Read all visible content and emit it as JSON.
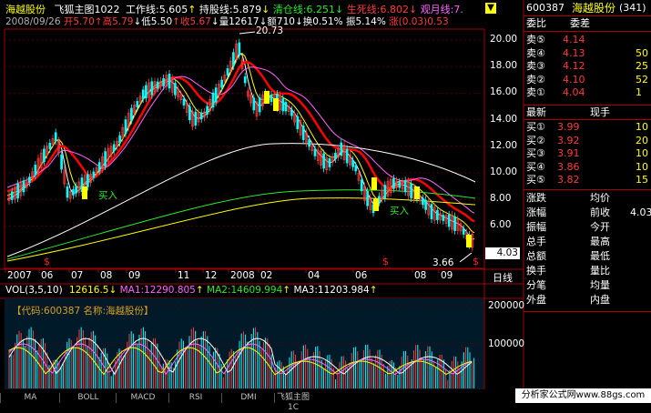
{
  "chart_header": {
    "stock_name": "海越股份",
    "indicator": "飞狐主图1022",
    "work_label": "工作线:5.605",
    "hold_label": "持股线:5.879",
    "clear_label": "清仓线:6.251",
    "life_label": "生死线:6.802",
    "month_label": "观月线:7."
  },
  "quote_line": {
    "date": "2008/09/26",
    "open": "开5.70",
    "high": "高5.79",
    "low": "低5.50",
    "close": "收5.67",
    "volume": "量12617",
    "amount": "额710",
    "turnover": "换0.51%",
    "amplitude": "振5.14%",
    "change": "涨(0.03)0.53"
  },
  "price_axis": [
    "20.00",
    "18.00",
    "16.00",
    "14.00",
    "12.00",
    "10.00",
    "8.00",
    "6.00"
  ],
  "current_price_tag": "4.03",
  "price_annotations": {
    "high": "20.73",
    "low": "3.66",
    "buy": "买入"
  },
  "time_axis": [
    "2007",
    "06",
    "07",
    "08",
    "09",
    "11",
    "12",
    "2008",
    "02",
    "04",
    "06",
    "08",
    "09"
  ],
  "period_label": "日线",
  "volume_header": {
    "vol_label": "VOL(3,5,10)",
    "vol_value": "12616.5",
    "ma1": "MA1:12290.805",
    "ma2": "MA2:14609.994",
    "ma3": "MA3:11203.984"
  },
  "volume_axis": [
    "200000",
    "100000"
  ],
  "volume_watermark": "【代码:600387 名称:海越股份】",
  "bottom_tabs": [
    "MA",
    "BOLL",
    "MACD",
    "RSI",
    "DMI",
    "飞狐主图1C"
  ],
  "right_panel": {
    "code": "600387",
    "name": "海越股份",
    "suffix": "(341)",
    "header_left": "委比",
    "header_right": "委差",
    "sell_rows": [
      {
        "label": "卖⑤",
        "price": "4.14"
      },
      {
        "label": "卖④",
        "price": "4.13",
        "vol": "50"
      },
      {
        "label": "卖③",
        "price": "4.12",
        "vol": "25"
      },
      {
        "label": "卖②",
        "price": "4.10",
        "vol": "52"
      },
      {
        "label": "卖①",
        "price": "4.04",
        "vol": "1"
      }
    ],
    "latest_label": "最新",
    "trade_label": "现手",
    "buy_rows": [
      {
        "label": "买①",
        "price": "3.99",
        "vol": "10"
      },
      {
        "label": "买②",
        "price": "3.92",
        "vol": "20"
      },
      {
        "label": "买③",
        "price": "3.91",
        "vol": "10"
      },
      {
        "label": "买④",
        "price": "3.86",
        "vol": "10"
      },
      {
        "label": "买⑤",
        "price": "3.82",
        "vol": "15"
      }
    ],
    "stats": [
      {
        "l": "涨跌",
        "r": "均价"
      },
      {
        "l": "涨幅",
        "r": "前收",
        "v": "4.03"
      },
      {
        "l": "振幅",
        "r": "今开"
      },
      {
        "l": "总手",
        "r": "最高"
      },
      {
        "l": "总额",
        "r": "最低"
      },
      {
        "l": "换手",
        "r": "量比"
      },
      {
        "l": "分笔",
        "r": "均量"
      },
      {
        "l": "外盘",
        "r": "内盘"
      }
    ]
  },
  "footer_banner": "分析家公式网www.88gs.com",
  "colors": {
    "bg": "#000000",
    "grid_red": "#a00000",
    "axis_red": "#ff0000",
    "up": "#ff3b3b",
    "down": "#00ffff",
    "yellow": "#ffff00",
    "green": "#2ee82e"
  }
}
